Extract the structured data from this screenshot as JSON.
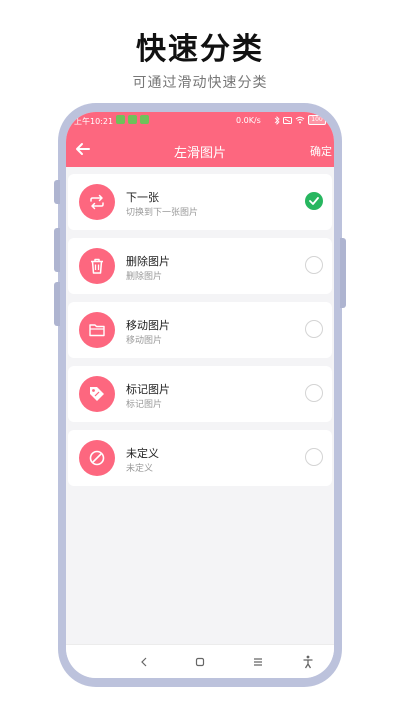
{
  "promo": {
    "title": "快速分类",
    "subtitle": "可通过滑动快速分类"
  },
  "status_bar": {
    "time": "上午10:21",
    "network_speed": "0.0K/s",
    "battery_level": "100"
  },
  "toolbar": {
    "title": "左滑图片",
    "confirm_label": "确定",
    "back_icon": "arrow-left-icon"
  },
  "options": [
    {
      "title": "下一张",
      "desc": "切换到下一张图片",
      "icon": "repeat-icon",
      "selected": true
    },
    {
      "title": "删除图片",
      "desc": "删除图片",
      "icon": "trash-icon",
      "selected": false
    },
    {
      "title": "移动图片",
      "desc": "移动图片",
      "icon": "folder-icon",
      "selected": false
    },
    {
      "title": "标记图片",
      "desc": "标记图片",
      "icon": "tag-icon",
      "selected": false
    },
    {
      "title": "未定义",
      "desc": "未定义",
      "icon": "ban-icon",
      "selected": false
    }
  ],
  "nav_bar": {
    "icons": [
      "back-nav-icon",
      "home-nav-icon",
      "menu-nav-icon",
      "accessibility-icon"
    ]
  },
  "colors": {
    "accent": "#fd677f",
    "selected": "#27b65f",
    "frame": "#bcc2dc"
  }
}
